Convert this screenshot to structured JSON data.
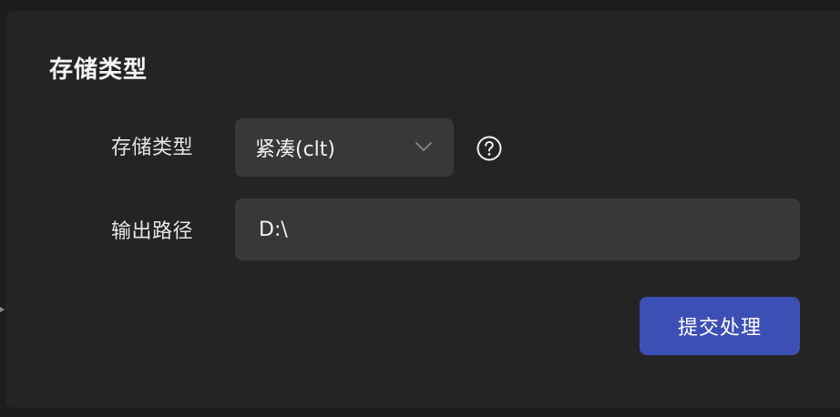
{
  "section": {
    "title": "存储类型"
  },
  "form": {
    "storage_type": {
      "label": "存储类型",
      "value": "紧凑(clt)",
      "chevron_icon": "chevron-down-icon",
      "help_icon": "question-circle-icon"
    },
    "output_path": {
      "label": "输出路径",
      "value": "D:\\"
    }
  },
  "actions": {
    "submit_label": "提交处理"
  },
  "colors": {
    "background": "#1d1d1d",
    "panel": "#242424",
    "field": "#383838",
    "accent": "#3c4fb4",
    "text": "#f0f0f0"
  }
}
